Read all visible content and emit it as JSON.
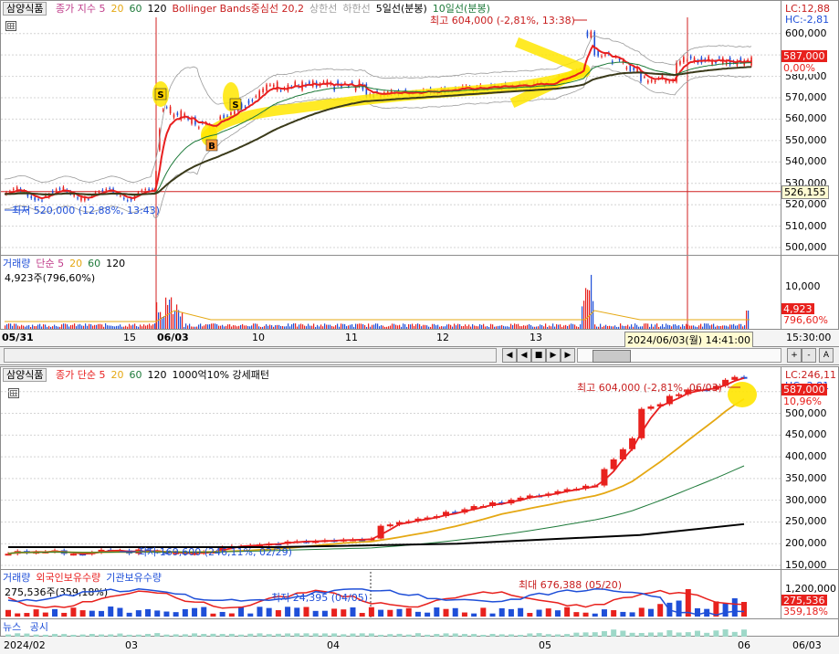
{
  "colors": {
    "up": "#e8211d",
    "down": "#1f4fd8",
    "ma5": "#e81f1f",
    "ma20": "#e5a813",
    "ma60": "#1e7a3a",
    "ma120": "#000000",
    "highlight": "#ffe600",
    "accentLine": "#cc2222"
  },
  "top": {
    "stock": "삼양식품",
    "legend": [
      {
        "text": "종가 지수 5",
        "color": "#c03c8a"
      },
      {
        "text": "20",
        "color": "#e5a813"
      },
      {
        "text": "60",
        "color": "#1e7a3a"
      },
      {
        "text": "120",
        "color": "#000000"
      },
      {
        "text": "Bollinger Bands중심선 20,2",
        "color": "#c81e1e"
      },
      {
        "text": "상한선",
        "color": "#a0a0a0"
      },
      {
        "text": "하한선",
        "color": "#a0a0a0"
      },
      {
        "text": "5일선(분봉)",
        "color": "#000000"
      },
      {
        "text": "10일선(분봉)",
        "color": "#1e7a3a"
      }
    ],
    "lc": "LC:12,88",
    "hc": "HC:-2,81",
    "max_label": "최고 604,000 (-2,81%, 13:38)",
    "min_label": "최저 520,000 (12,88%, 13:43)",
    "price_badge": "587,000",
    "pct_badge": "0,00%",
    "hline_badge": "526,155",
    "yticks": [
      "600,000",
      "590,000",
      "580,000",
      "570,000",
      "560,000",
      "550,000",
      "540,000",
      "530,000",
      "520,000",
      "510,000",
      "500,000"
    ],
    "signals": [
      "S",
      "S",
      "B"
    ]
  },
  "vol1": {
    "legend": [
      {
        "text": "거래량",
        "color": "#1f4fd8"
      },
      {
        "text": "단순 5",
        "color": "#c03c8a"
      },
      {
        "text": "20",
        "color": "#e5a813"
      },
      {
        "text": "60",
        "color": "#1e7a3a"
      },
      {
        "text": "120",
        "color": "#000000"
      }
    ],
    "value": "4,923주(796,60%)",
    "ytick": "10,000",
    "badge1": "4,923",
    "badge2": "796,60%"
  },
  "xaxis1": {
    "labels": [
      "05/31",
      "15",
      "06/03",
      "10",
      "11",
      "12",
      "13"
    ],
    "cursor": "2024/06/03(월) 14:41:00",
    "time": "15:30:00"
  },
  "toolbar": {
    "buttons": [
      "◀",
      "■",
      "▶",
      "+",
      "-",
      "A"
    ]
  },
  "bottom": {
    "stock": "삼양식품",
    "legend": [
      {
        "text": "종가 단순 5",
        "color": "#e81f1f"
      },
      {
        "text": "20",
        "color": "#e5a813"
      },
      {
        "text": "60",
        "color": "#1e7a3a"
      },
      {
        "text": "120",
        "color": "#000000"
      },
      {
        "text": "1000억10% 강세패턴",
        "color": "#000000"
      }
    ],
    "lc": "LC:246,11",
    "hc": "HC:-2,81",
    "max_label": "최고 604,000 (-2,81%, 06/03)",
    "min_label": "최저 169,600 (246,11%, 02/29)",
    "price_badge": "587,000",
    "pct_badge": "10,96%",
    "yticks": [
      "550,000",
      "500,000",
      "450,000",
      "400,000",
      "350,000",
      "300,000",
      "250,000",
      "200,000",
      "150,000"
    ]
  },
  "vol2": {
    "legend": [
      {
        "text": "거래량",
        "color": "#1f4fd8"
      },
      {
        "text": "외국인보유수량",
        "color": "#e81f1f"
      },
      {
        "text": "기관보유수량",
        "color": "#1f4fd8"
      }
    ],
    "value": "275,536주(359,18%)",
    "max_label": "최대 676,388 (05/20)",
    "min_label": "최저 24,395 (04/05)",
    "ytick": "1,200,000",
    "badge1": "275,536",
    "badge2": "359,18%"
  },
  "news": {
    "labels": [
      "뉴스",
      "공시"
    ]
  },
  "xaxis2": {
    "labels": [
      "2024/02",
      "03",
      "04",
      "05",
      "06"
    ],
    "right": "06/03"
  },
  "chart_data": [
    {
      "type": "line",
      "title": "삼양식품 분봉",
      "series": [
        {
          "name": "종가",
          "x": [
            "05/31",
            "06/03 09:00",
            "06/03 09:30",
            "06/03 10:00",
            "06/03 11:00",
            "06/03 12:00",
            "06/03 13:00",
            "06/03 13:38",
            "06/03 14:00",
            "06/03 14:41",
            "06/03 15:30"
          ],
          "values": [
            526000,
            526000,
            560000,
            565000,
            575000,
            572000,
            573000,
            604000,
            578000,
            583000,
            587000
          ]
        }
      ],
      "ylim": [
        500000,
        605000
      ],
      "annotations": [
        "최고 604,000 (-2,81%, 13:38)",
        "최저 520,000 (12,88%, 13:43)"
      ]
    },
    {
      "type": "bar",
      "categories": [
        "2024/02",
        "03",
        "04",
        "05",
        "06"
      ],
      "series": [
        {
          "name": "종가",
          "values": [
            175000,
            195000,
            260000,
            310000,
            587000
          ]
        }
      ],
      "ylim": [
        150000,
        600000
      ],
      "annotations": [
        "최고 604,000 (-2,81%, 06/03)",
        "최저 169,600 (246,11%, 02/29)"
      ]
    }
  ]
}
